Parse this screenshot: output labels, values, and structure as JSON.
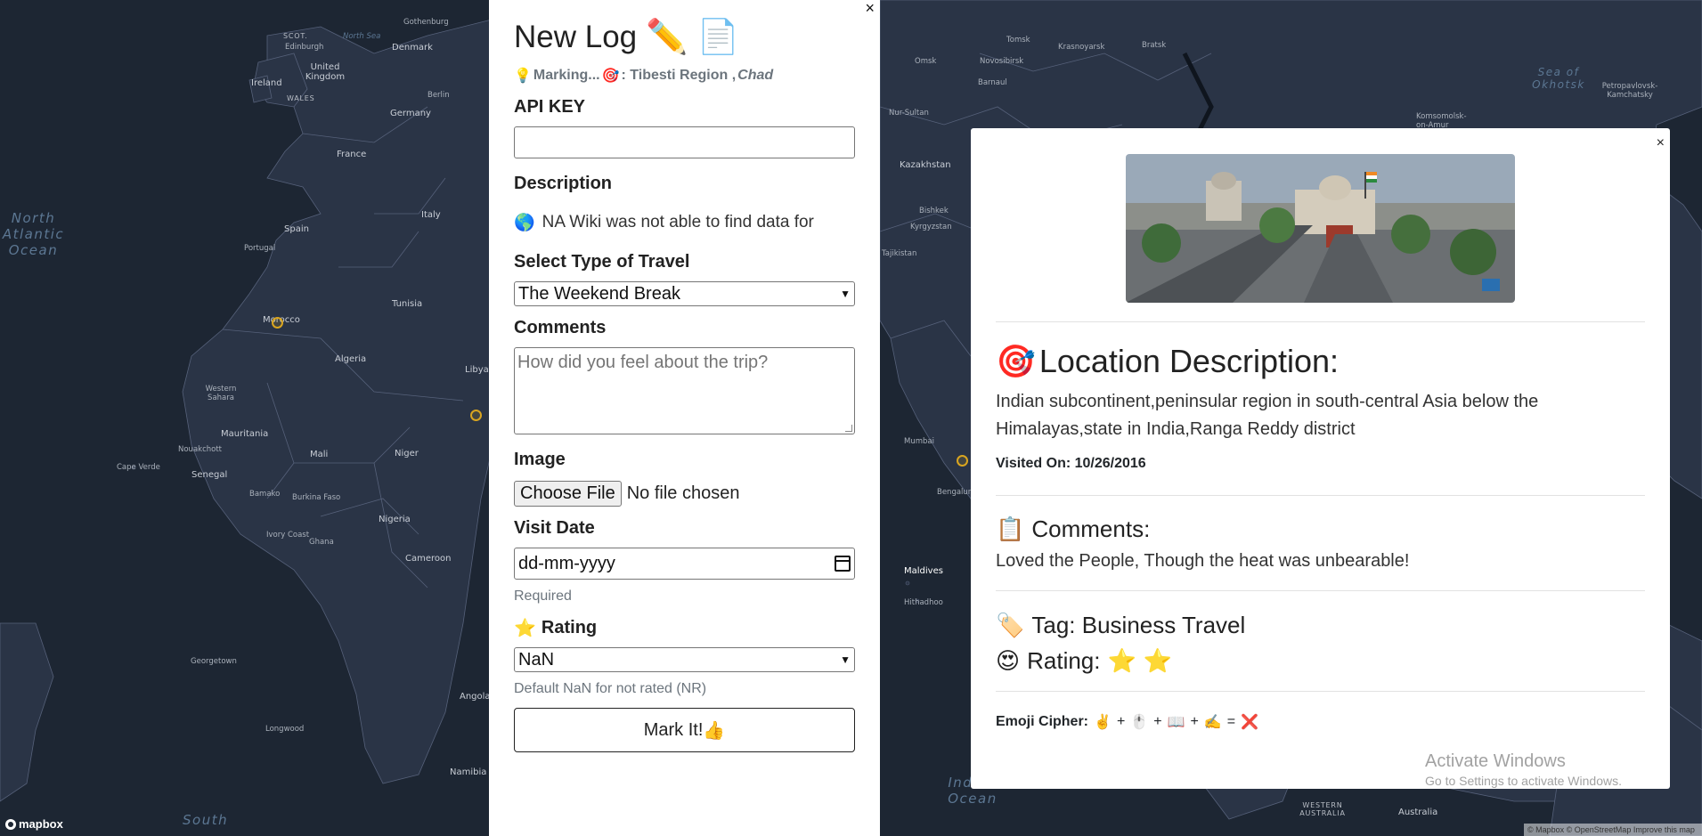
{
  "map": {
    "labels": [
      {
        "text": "Gothenburg",
        "cls": "small"
      },
      {
        "text": "SCOT.",
        "cls": "caps"
      },
      {
        "text": "Edinburgh",
        "cls": "small"
      },
      {
        "text": "North Sea",
        "cls": "small"
      },
      {
        "text": "Denmark",
        "cls": ""
      },
      {
        "text": "United Kingdom",
        "cls": ""
      },
      {
        "text": "Ireland",
        "cls": ""
      },
      {
        "text": "WALES",
        "cls": "caps"
      },
      {
        "text": "Germany",
        "cls": ""
      },
      {
        "text": "Berlin",
        "cls": "small"
      },
      {
        "text": "France",
        "cls": ""
      },
      {
        "text": "Spain",
        "cls": ""
      },
      {
        "text": "Italy",
        "cls": ""
      },
      {
        "text": "Portugal",
        "cls": "small"
      },
      {
        "text": "Morocco",
        "cls": ""
      },
      {
        "text": "Algeria",
        "cls": ""
      },
      {
        "text": "Tunisia",
        "cls": ""
      },
      {
        "text": "Libya",
        "cls": ""
      },
      {
        "text": "Western Sahara",
        "cls": "small"
      },
      {
        "text": "Mauritania",
        "cls": ""
      },
      {
        "text": "Mali",
        "cls": ""
      },
      {
        "text": "Niger",
        "cls": ""
      },
      {
        "text": "Nigeria",
        "cls": ""
      },
      {
        "text": "Senegal",
        "cls": ""
      },
      {
        "text": "Cape Verde",
        "cls": "small"
      },
      {
        "text": "Nouakchott",
        "cls": "small"
      },
      {
        "text": "Bamako",
        "cls": "small"
      },
      {
        "text": "Burkina Faso",
        "cls": "small"
      },
      {
        "text": "Ghana",
        "cls": "small"
      },
      {
        "text": "Ivory Coast",
        "cls": "small"
      },
      {
        "text": "Cameroon",
        "cls": ""
      },
      {
        "text": "Angola",
        "cls": ""
      },
      {
        "text": "Namibia",
        "cls": ""
      },
      {
        "text": "Georgetown",
        "cls": "small"
      },
      {
        "text": "Longwood",
        "cls": "small"
      },
      {
        "text": "Kazakhstan",
        "cls": ""
      },
      {
        "text": "Kyrgyzstan",
        "cls": "small"
      },
      {
        "text": "Tajikistan",
        "cls": "small"
      },
      {
        "text": "Mumbai",
        "cls": "small"
      },
      {
        "text": "Bengaluru",
        "cls": "small"
      },
      {
        "text": "Maldives",
        "cls": ""
      },
      {
        "text": "Hithadhoo",
        "cls": "small"
      },
      {
        "text": "Omsk",
        "cls": "small"
      },
      {
        "text": "Tomsk",
        "cls": "small"
      },
      {
        "text": "Novosibirsk",
        "cls": "small"
      },
      {
        "text": "Krasnoyarsk",
        "cls": "small"
      },
      {
        "text": "Bratsk",
        "cls": "small"
      },
      {
        "text": "Barnaul",
        "cls": "small"
      },
      {
        "text": "Nur-Sultan",
        "cls": "small"
      },
      {
        "text": "Bishkek",
        "cls": "small"
      },
      {
        "text": "WESTERN AUSTRALIA",
        "cls": "caps"
      },
      {
        "text": "Australia",
        "cls": ""
      },
      {
        "text": "Komsomolsk-on-Amur",
        "cls": "small"
      },
      {
        "text": "Petropavlovsk-Kamchatsky",
        "cls": "small"
      }
    ],
    "oceans": [
      {
        "text": "North Atlantic Ocean"
      },
      {
        "text": "South"
      },
      {
        "text": "Sea of Okhotsk"
      },
      {
        "text": "Indian Ocean"
      }
    ],
    "logo": "mapbox",
    "attribution": "© Mapbox © OpenStreetMap Improve this map"
  },
  "log_panel": {
    "title": "New Log",
    "title_icons": [
      "pencil-icon",
      "document-icon"
    ],
    "close": "×",
    "marking_prefix": "Marking...",
    "marking_place": ": Tibesti Region ,",
    "marking_country": "Chad",
    "api_key_label": "API KEY",
    "api_key_value": "",
    "description_label": "Description",
    "description_text": "NA Wiki was not able to find data for",
    "travel_type_label": "Select Type of Travel",
    "travel_type_value": "The Weekend Break",
    "comments_label": "Comments",
    "comments_placeholder": "How did you feel about the trip?",
    "image_label": "Image",
    "choose_file_label": "Choose File",
    "no_file_text": "No file chosen",
    "visit_date_label": "Visit Date",
    "visit_date_placeholder": "dd-mm-yyyy",
    "required_hint": "Required",
    "rating_label": "Rating",
    "rating_value": "NaN",
    "rating_hint": "Default NaN for not rated (NR)",
    "submit_label": "Mark It!"
  },
  "detail_popup": {
    "close": "×",
    "location_title": "Location Description:",
    "location_text": "Indian subcontinent,peninsular region in south-central Asia below the Himalayas,state in India,Ranga Reddy district",
    "visited_on": "Visited On: 10/26/2016",
    "comments_title": "Comments:",
    "comments_text": "Loved the People, Though the heat was unbearable!",
    "tag_text": "Tag: Business Travel",
    "rating_text": "Rating:",
    "rating_stars": 2,
    "emoji_cipher_label": "Emoji Cipher:",
    "cipher_plus": "+",
    "cipher_equals": "="
  },
  "windows_watermark": {
    "line1": "Activate Windows",
    "line2": "Go to Settings to activate Windows."
  },
  "colors": {
    "map_bg": "#1d2633",
    "land": "#2a3446",
    "marker": "#d9a520"
  }
}
